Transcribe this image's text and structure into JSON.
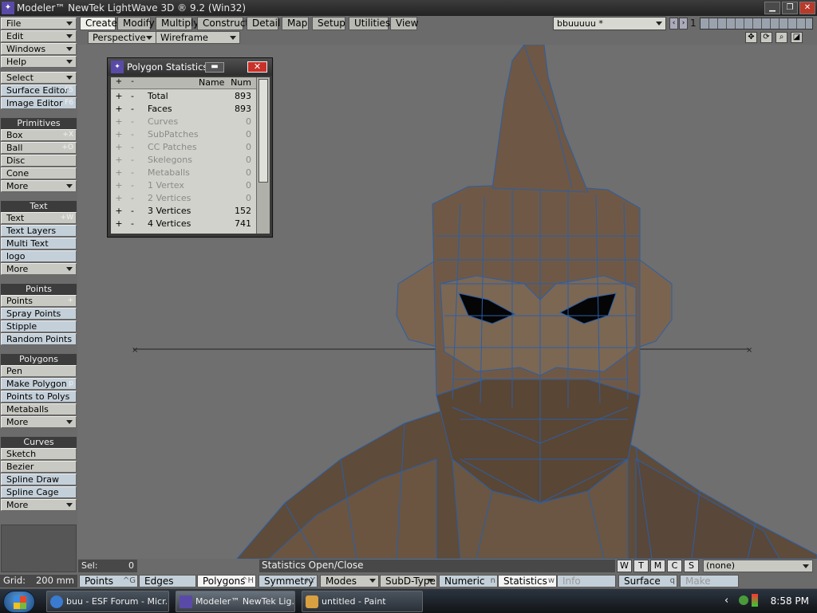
{
  "window": {
    "title": "Modeler™ NewTek LightWave 3D ® 9.2 (Win32)"
  },
  "left_menu": {
    "file": "File",
    "edit": "Edit",
    "windows": "Windows",
    "help": "Help",
    "select": "Select",
    "surface_editor": "Surface Editor",
    "surface_editor_sc": "F5",
    "image_editor": "Image Editor",
    "image_editor_sc": "F6",
    "primitives_head": "Primitives",
    "box": "Box",
    "box_sc": "+X",
    "ball": "Ball",
    "ball_sc": "+O",
    "disc": "Disc",
    "cone": "Cone",
    "more": "More",
    "text_head": "Text",
    "text": "Text",
    "text_sc": "+W",
    "text_layers": "Text Layers",
    "multi_text": "Multi Text",
    "logo": "logo",
    "points_head": "Points",
    "points": "Points",
    "points_sc": "+",
    "spray_points": "Spray Points",
    "stipple": "Stipple",
    "random_points": "Random Points",
    "polygons_head": "Polygons",
    "pen": "Pen",
    "make_polygon": "Make Polygon",
    "make_polygon_sc": "p",
    "points_to_polys": "Points to Polys",
    "metaballs": "Metaballs",
    "curves_head": "Curves",
    "sketch": "Sketch",
    "bezier": "Bezier",
    "spline_draw": "Spline Draw",
    "spline_cage": "Spline Cage"
  },
  "tabs": [
    "Create",
    "Modify",
    "Multiply",
    "Construct",
    "Detail",
    "Map",
    "Setup",
    "Utilities",
    "View"
  ],
  "object_select": "bbuuuuu *",
  "layer_num": "1",
  "viewport": {
    "view": "Perspective",
    "shading": "Wireframe Shade"
  },
  "stats": {
    "title": "Polygon Statistics",
    "col_name": "Name",
    "col_num": "Num",
    "rows": [
      {
        "name": "Total",
        "num": "893"
      },
      {
        "name": "Faces",
        "num": "893"
      },
      {
        "name": "Curves",
        "num": "0"
      },
      {
        "name": "SubPatches",
        "num": "0"
      },
      {
        "name": "CC Patches",
        "num": "0"
      },
      {
        "name": "Skelegons",
        "num": "0"
      },
      {
        "name": "Metaballs",
        "num": "0"
      },
      {
        "name": "1 Vertex",
        "num": "0"
      },
      {
        "name": "2 Vertices",
        "num": "0"
      },
      {
        "name": "3 Vertices",
        "num": "152"
      },
      {
        "name": "4 Vertices",
        "num": "741"
      }
    ]
  },
  "status": {
    "sel_label": "Sel:",
    "sel_value": "0",
    "info": "Statistics Open/Close",
    "w": "W",
    "t": "T",
    "m": "M",
    "c": "C",
    "s": "S",
    "surface": "(none)"
  },
  "bottom": {
    "grid_label": "Grid:",
    "grid_value": "200 mm",
    "points": "Points",
    "points_sc": "^G",
    "edges": "Edges",
    "polygons": "Polygons",
    "polygons_sc": "^H",
    "symmetry": "Symmetry",
    "symmetry_sc": "+Y",
    "modes": "Modes",
    "subd": "SubD-Type",
    "numeric": "Numeric",
    "numeric_sc": "n",
    "statistics": "Statistics",
    "statistics_sc": "w",
    "info": "Info",
    "surface": "Surface",
    "surface_sc": "q",
    "make": "Make"
  },
  "taskbar": {
    "task1": "buu - ESF Forum - Micr...",
    "task2": "Modeler™ NewTek Lig...",
    "task3": "untitled - Paint",
    "clock": "8:58 PM"
  },
  "colors": {
    "model_fill": "#6a5642",
    "wire": "#2a5fa8",
    "viewport": "#6f6f6f"
  }
}
